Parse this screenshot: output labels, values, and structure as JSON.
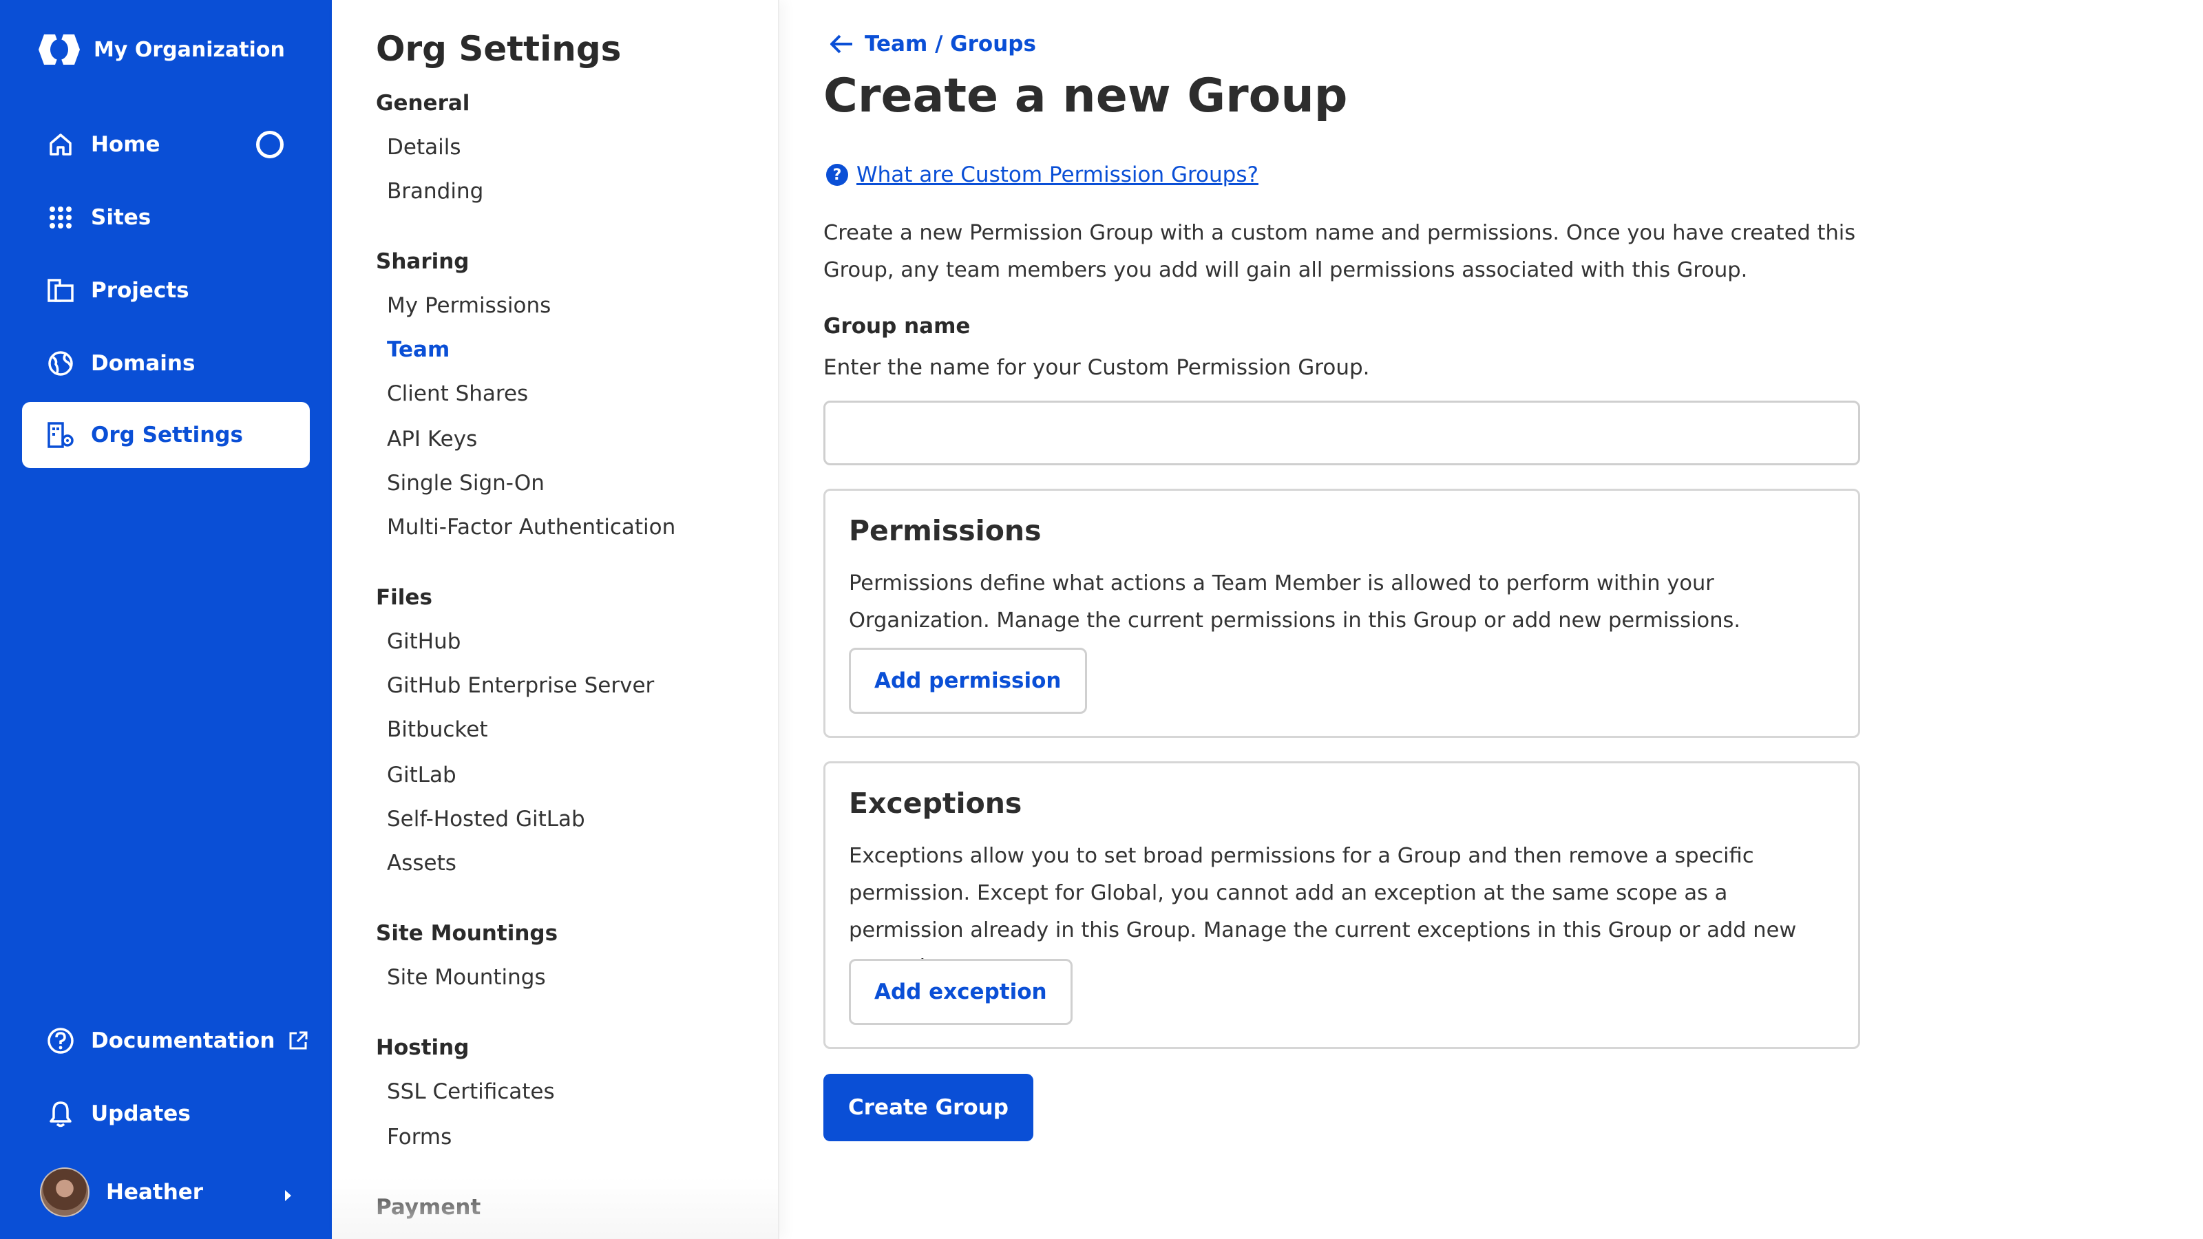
{
  "app": {
    "org_name": "My Organization"
  },
  "nav": {
    "items": [
      {
        "label": "Home",
        "icon": "home-icon"
      },
      {
        "label": "Sites",
        "icon": "grid-icon"
      },
      {
        "label": "Projects",
        "icon": "projects-icon"
      },
      {
        "label": "Domains",
        "icon": "globe-icon"
      },
      {
        "label": "Org Settings",
        "icon": "org-settings-icon",
        "active": true
      }
    ],
    "bottom": [
      {
        "label": "Documentation",
        "icon": "help-circle-icon"
      },
      {
        "label": "Updates",
        "icon": "bell-icon"
      }
    ],
    "user": {
      "name": "Heather"
    }
  },
  "settings": {
    "title": "Org Settings",
    "sections": [
      {
        "heading": "General",
        "links": [
          "Details",
          "Branding"
        ]
      },
      {
        "heading": "Sharing",
        "links": [
          "My Permissions",
          "Team",
          "Client Shares",
          "API Keys",
          "Single Sign-On",
          "Multi-Factor Authentication"
        ]
      },
      {
        "heading": "Files",
        "links": [
          "GitHub",
          "GitHub Enterprise Server",
          "Bitbucket",
          "GitLab",
          "Self-Hosted GitLab",
          "Assets"
        ]
      },
      {
        "heading": "Site Mountings",
        "links": [
          "Site Mountings"
        ]
      },
      {
        "heading": "Hosting",
        "links": [
          "SSL Certificates",
          "Forms"
        ]
      },
      {
        "heading": "Payment",
        "links": []
      }
    ],
    "active_link": "Team"
  },
  "main": {
    "breadcrumb": "Team / Groups",
    "title": "Create a new Group",
    "help_link": "What are Custom Permission Groups?",
    "intro": "Create a new Permission Group with a custom name and permissions. Once you have created this Group, any team members you add will gain all permissions associated with this Group.",
    "group_name_label": "Group name",
    "group_name_help": "Enter the name for your Custom Permission Group.",
    "group_name_value": "",
    "permissions": {
      "title": "Permissions",
      "text": "Permissions define what actions a Team Member is allowed to perform within your Organization. Manage the current permissions in this Group or add new permissions.",
      "button": "Add permission"
    },
    "exceptions": {
      "title": "Exceptions",
      "text": "Exceptions allow you to set broad permissions for a Group and then remove a specific permission. Except for Global, you cannot add an exception at the same scope as a permission already in this Group. Manage the current exceptions in this Group or add new exceptions.",
      "button": "Add exception"
    },
    "submit": "Create Group"
  },
  "colors": {
    "brand": "#0a4fd6",
    "text": "#2d2d2d",
    "border": "#d6d6d6"
  }
}
